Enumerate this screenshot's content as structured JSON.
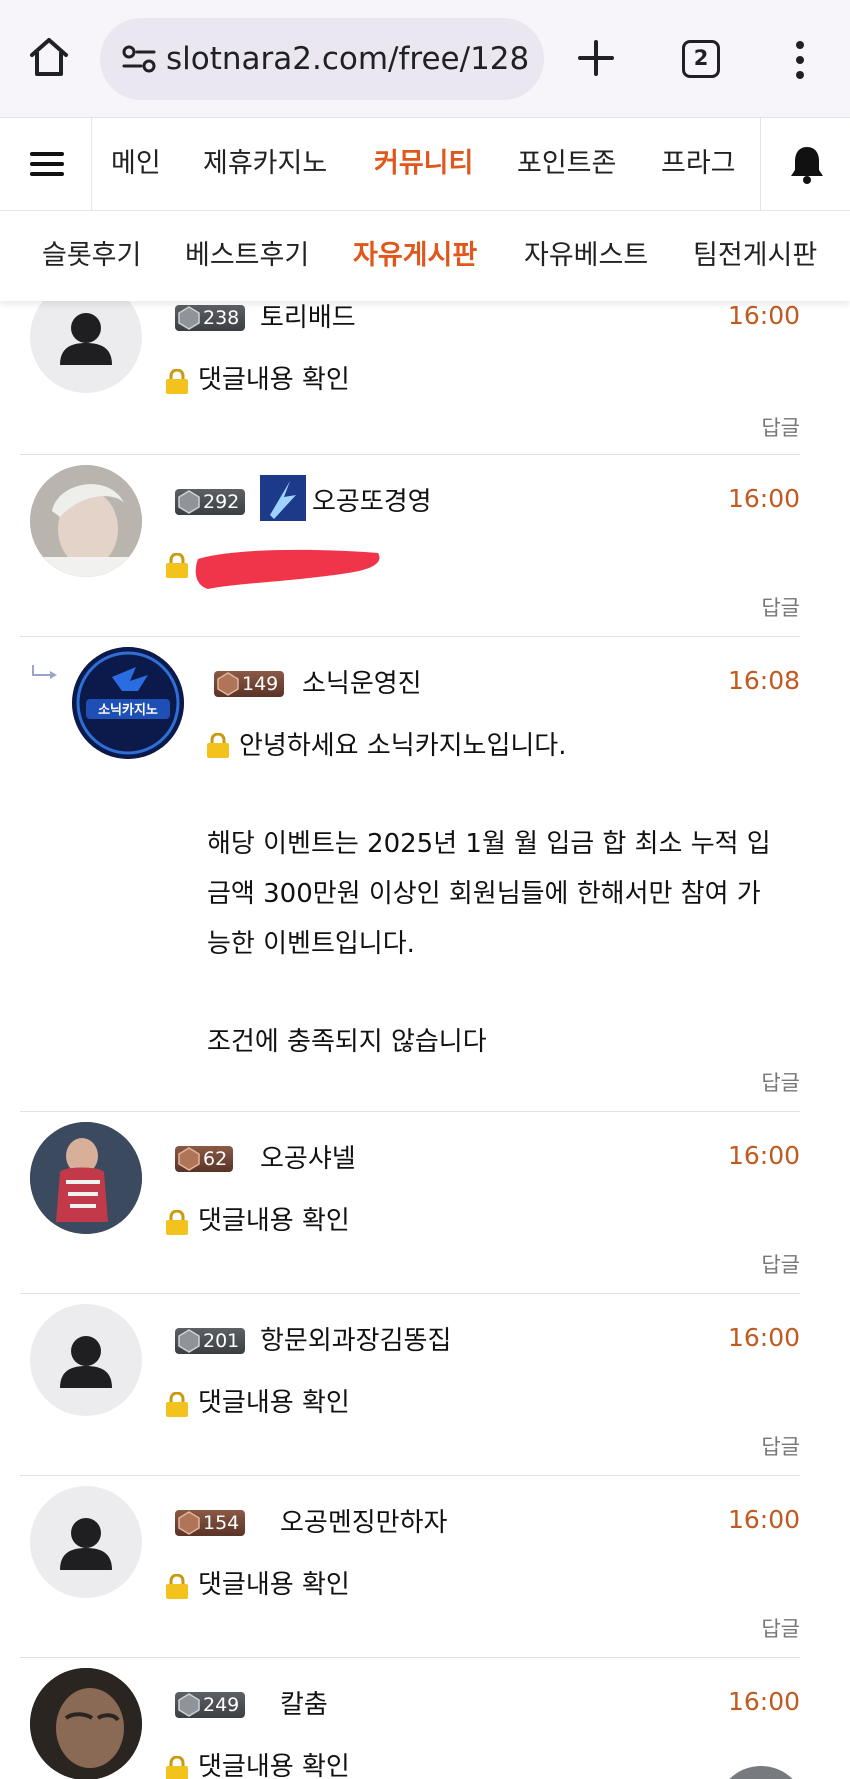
{
  "browser": {
    "url": "slotnara2.com/free/128",
    "tab_count": "2"
  },
  "nav_main": {
    "items": [
      "메인",
      "제휴카지노",
      "커뮤니티",
      "포인트존",
      "프라그"
    ],
    "active": "커뮤니티"
  },
  "nav_sub": {
    "items": [
      "슬롯후기",
      "베스트후기",
      "자유게시판",
      "자유베스트",
      "팀전게시판"
    ],
    "active": "자유게시판"
  },
  "comments": [
    {
      "level": "238",
      "name": "토리배드",
      "time": "16:00",
      "text": "댓글내용 확인",
      "reply": "답글",
      "avatar": "default",
      "is_reply": false
    },
    {
      "level": "292",
      "name": "오공또경영",
      "time": "16:00",
      "text": "",
      "reply": "답글",
      "avatar": "photo",
      "is_reply": false,
      "redacted": true
    },
    {
      "level": "149",
      "name": "소닉운영진",
      "time": "16:08",
      "text": "안녕하세요 소닉카지노입니다.",
      "text2": "해당 이벤트는 2025년 1월 월 입금 합 최소 누적 입\n금액 300만원 이상인 회원님들에 한해서만 참여 가\n능한 이벤트입니다.",
      "text3": "조건에 충족되지 않습니다",
      "reply": "답글",
      "avatar": "logo",
      "avatar_text": "소닉카지노",
      "is_reply": true
    },
    {
      "level": "62",
      "name": "오공샤넬",
      "time": "16:00",
      "text": "댓글내용 확인",
      "reply": "답글",
      "avatar": "photo",
      "is_reply": false
    },
    {
      "level": "201",
      "name": "항문외과장김똥집",
      "time": "16:00",
      "text": "댓글내용 확인",
      "reply": "답글",
      "avatar": "default",
      "is_reply": false
    },
    {
      "level": "154",
      "name": "오공멘징만하자",
      "time": "16:00",
      "text": "댓글내용 확인",
      "reply": "답글",
      "avatar": "default",
      "is_reply": false
    },
    {
      "level": "249",
      "name": "칼춤",
      "time": "16:00",
      "text": "댓글내용 확인",
      "reply": "",
      "avatar": "photo",
      "is_reply": false
    }
  ],
  "colors": {
    "accent": "#e0561b",
    "time": "#c2591f",
    "redaction": "#f0354a"
  }
}
